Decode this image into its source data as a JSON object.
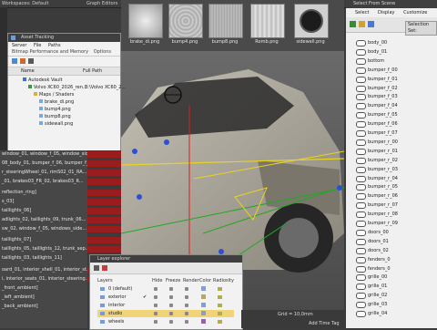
{
  "topbar": {
    "workspace": "Workspaces: Default",
    "menu": [
      "Graph Editors",
      "Rendering"
    ]
  },
  "thumbnails": [
    {
      "label": "brake_di.png"
    },
    {
      "label": "bump4.png"
    },
    {
      "label": "bump8.png"
    },
    {
      "label": "Romb.png"
    },
    {
      "label": "sidewall.png"
    }
  ],
  "asset_tracking": {
    "title": "Asset Tracking",
    "menu": [
      "Server",
      "File",
      "Paths"
    ],
    "submenu": [
      "Bitmap Performance and Memory",
      "Options"
    ],
    "columns": {
      "name": "Name",
      "path": "Full Path"
    },
    "tree": [
      {
        "label": "Autodesk Vault",
        "path": ""
      },
      {
        "label": "Volvo XC60_2026_ren...",
        "path": "B:\\Volvo XC60_2..."
      },
      {
        "label": "Maps / Shaders",
        "path": ""
      },
      {
        "label": "brake_di.png",
        "path": ""
      },
      {
        "label": "bump4.png",
        "path": ""
      },
      {
        "label": "bump8.png",
        "path": ""
      },
      {
        "label": "sidewall.png",
        "path": ""
      }
    ]
  },
  "command_list": [
    "window_01, window_f_05, window_sid...",
    "08_body_01, bumper_f_06, bumper_f_0...",
    "r_steeringWheel_01, rimS02_01_RA...",
    "_01, brakes03_FR_02, brakes03_R...",
    "reflection_ring]",
    "s_03]",
    "taillights_06]",
    "adlights_02, taillights_09, trunk_06...",
    "sw_02, window_f_05, windows_side...",
    "taillights_07]",
    "taillights_05, taillights_12, trunk_sep...",
    "taillights_03, taillights_11]",
    "oard_01, interior_shell_01, interior_st...",
    "i, interior_seats_01, interior_steering...",
    "_front_ambient]",
    "_left_ambient]",
    "_back_ambient]"
  ],
  "scene_explorer": {
    "title": "Select From Scene",
    "menu": [
      "Select",
      "Display",
      "Customize"
    ],
    "selection_set_label": "Selection Set:",
    "items": [
      "body_00",
      "body_01",
      "bottom",
      "bumper_f_00",
      "bumper_f_01",
      "bumper_f_02",
      "bumper_f_03",
      "bumper_f_04",
      "bumper_f_05",
      "bumper_f_06",
      "bumper_f_07",
      "bumper_r_00",
      "bumper_r_01",
      "bumper_r_02",
      "bumper_r_03",
      "bumper_r_04",
      "bumper_r_05",
      "bumper_r_06",
      "bumper_r_07",
      "bumper_r_08",
      "bumper_r_09",
      "doors_00",
      "doors_01",
      "doors_02",
      "fenders_0",
      "fenders_0",
      "grille_00",
      "grille_01",
      "grille_02",
      "grille_03",
      "grille_04"
    ]
  },
  "layer_explorer": {
    "title": "Layer explorer",
    "columns": [
      "Layers",
      "Hide",
      "Freeze",
      "Render",
      "Color",
      "Radiosity"
    ],
    "layers": [
      {
        "name": "0 (default)",
        "color": "#7ea0d8",
        "active": false,
        "selected": false
      },
      {
        "name": "exterior",
        "color": "#c9a24a",
        "active": true,
        "selected": false
      },
      {
        "name": "interior",
        "color": "#7ea0d8",
        "active": false,
        "selected": false
      },
      {
        "name": "studio",
        "color": "#7ea0d8",
        "active": false,
        "selected": true
      },
      {
        "name": "wheels",
        "color": "#a060a0",
        "active": false,
        "selected": false
      }
    ]
  },
  "viewport_bottom": {
    "grid": "Grid = 10,0mm",
    "add_time_tag": "Add Time Tag"
  }
}
